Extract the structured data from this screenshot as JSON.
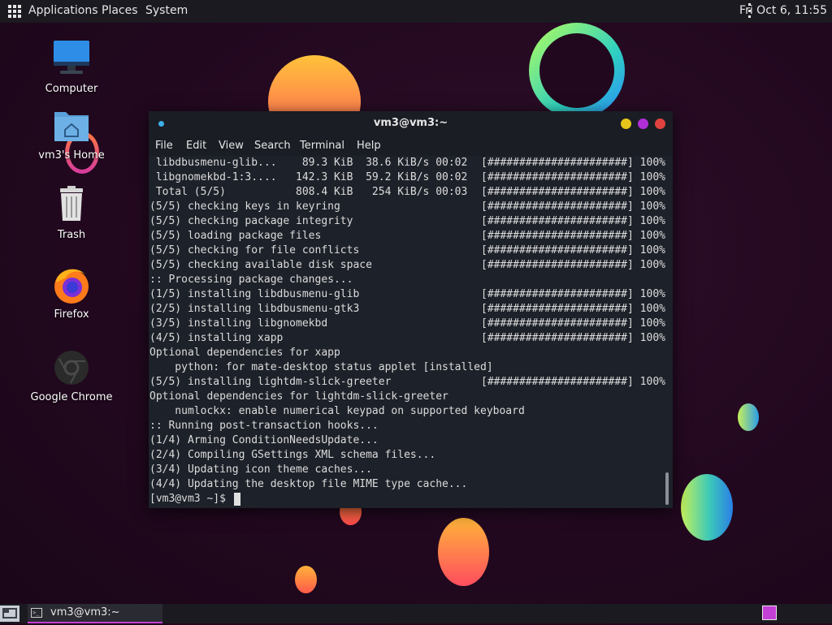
{
  "top_panel": {
    "menus": [
      "Applications",
      "Places",
      "System"
    ],
    "clock": "Fri Oct  6, 11:55",
    "apps_icon": "apps-grid-icon"
  },
  "desktop": {
    "icons": [
      {
        "label": "Computer",
        "icon": "computer-icon"
      },
      {
        "label": "vm3's Home",
        "icon": "home-folder-icon"
      },
      {
        "label": "Trash",
        "icon": "trash-icon"
      },
      {
        "label": "Firefox",
        "icon": "firefox-icon"
      },
      {
        "label": "Google Chrome",
        "icon": "chrome-icon"
      }
    ]
  },
  "terminal": {
    "title": "vm3@vm3:~",
    "menu": [
      "File",
      "Edit",
      "View",
      "Search",
      "Terminal",
      "Help"
    ],
    "lines": [
      {
        "text": " libdbusmenu-glib...    89.3 KiB  38.6 KiB/s 00:02",
        "progress": "[######################] 100%"
      },
      {
        "text": " libgnomekbd-1:3....   142.3 KiB  59.2 KiB/s 00:02",
        "progress": "[######################] 100%"
      },
      {
        "text": " Total (5/5)           808.4 KiB   254 KiB/s 00:03",
        "progress": "[######################] 100%"
      },
      {
        "text": "(5/5) checking keys in keyring",
        "progress": "[######################] 100%"
      },
      {
        "text": "(5/5) checking package integrity",
        "progress": "[######################] 100%"
      },
      {
        "text": "(5/5) loading package files",
        "progress": "[######################] 100%"
      },
      {
        "text": "(5/5) checking for file conflicts",
        "progress": "[######################] 100%"
      },
      {
        "text": "(5/5) checking available disk space",
        "progress": "[######################] 100%"
      },
      {
        "text": ":: Processing package changes...",
        "progress": ""
      },
      {
        "text": "(1/5) installing libdbusmenu-glib",
        "progress": "[######################] 100%"
      },
      {
        "text": "(2/5) installing libdbusmenu-gtk3",
        "progress": "[######################] 100%"
      },
      {
        "text": "(3/5) installing libgnomekbd",
        "progress": "[######################] 100%"
      },
      {
        "text": "(4/5) installing xapp",
        "progress": "[######################] 100%"
      },
      {
        "text": "Optional dependencies for xapp",
        "progress": ""
      },
      {
        "text": "    python: for mate-desktop status applet [installed]",
        "progress": ""
      },
      {
        "text": "(5/5) installing lightdm-slick-greeter",
        "progress": "[######################] 100%"
      },
      {
        "text": "Optional dependencies for lightdm-slick-greeter",
        "progress": ""
      },
      {
        "text": "    numlockx: enable numerical keypad on supported keyboard",
        "progress": ""
      },
      {
        "text": ":: Running post-transaction hooks...",
        "progress": ""
      },
      {
        "text": "(1/4) Arming ConditionNeedsUpdate...",
        "progress": ""
      },
      {
        "text": "(2/4) Compiling GSettings XML schema files...",
        "progress": ""
      },
      {
        "text": "(3/4) Updating icon theme caches...",
        "progress": ""
      },
      {
        "text": "(4/4) Updating the desktop file MIME type cache...",
        "progress": ""
      }
    ],
    "prompt": "[vm3@vm3 ~]$ "
  },
  "bottom_panel": {
    "task_label": "vm3@vm3:~",
    "show_desktop_icon": "show-desktop-icon",
    "terminal_icon": "terminal-icon",
    "workspace_icon": "workspace-switcher-icon"
  },
  "colors": {
    "panel_bg": "#1b1a20",
    "terminal_bg": "#1d2129",
    "btn_yellow": "#e5c51a",
    "btn_purple": "#b02fd6",
    "btn_red": "#e0423f",
    "accent": "#3daee9"
  }
}
